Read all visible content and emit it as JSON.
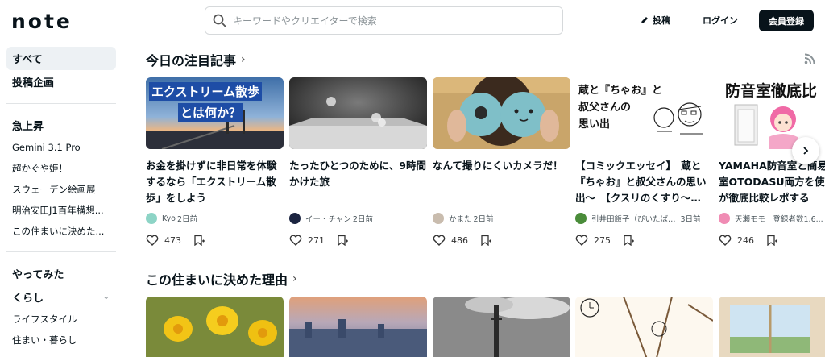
{
  "header": {
    "logo": "note",
    "search_placeholder": "キーワードやクリエイターで検索",
    "post_label": "投稿",
    "login_label": "ログイン",
    "signup_label": "会員登録"
  },
  "sidebar": {
    "top": [
      {
        "label": "すべて"
      },
      {
        "label": "投稿企画"
      }
    ],
    "trending_heading": "急上昇",
    "trending": [
      {
        "label": "Gemini 3.1 Pro"
      },
      {
        "label": "超かぐや姫！"
      },
      {
        "label": "スウェーデン絵画展"
      },
      {
        "label": "明治安田J1百年構想..."
      },
      {
        "label": "この住まいに決めた..."
      }
    ],
    "tried_heading": "やってみた",
    "life_heading": "くらし",
    "life": [
      {
        "label": "ライフスタイル"
      },
      {
        "label": "住まい・暮らし"
      }
    ]
  },
  "section1": {
    "title": "今日の注目記事",
    "cards": [
      {
        "thumb_text_1": "エクストリーム散歩",
        "thumb_text_2": "とは何か？",
        "title": "お金を掛けずに非日常を体験するなら「エクストリーム散歩」をしよう",
        "author": "Kyo",
        "time": "2日前",
        "likes": "473"
      },
      {
        "title": "たったひとつのために、9時間かけた旅",
        "author": "イー・チャン",
        "time": "2日前",
        "likes": "271"
      },
      {
        "title": "なんて撮りにくいカメラだ！",
        "author": "かまた",
        "time": "2日前",
        "likes": "486"
      },
      {
        "thumb_text_1": "蔵と『ちゃお』と",
        "thumb_text_2": "叔父さんの",
        "thumb_text_3": "思い出",
        "title": "【コミックエッセイ】　蔵と『ちゃお』と叔父さんの思い出〜　【クスリのくすり〜…",
        "author": "引井田飯子（ぴいたば…",
        "time": "3日前",
        "likes": "275"
      },
      {
        "thumb_text_1": "防音室徹底比",
        "title": "YAMAHA防音室と簡易防音室OTODASU両方を使った私が徹底比較レポする",
        "author": "天瀬モモ｜登録者数1.6...",
        "time": "",
        "likes": "246"
      }
    ]
  },
  "section2": {
    "title": "この住まいに決めた理由"
  }
}
